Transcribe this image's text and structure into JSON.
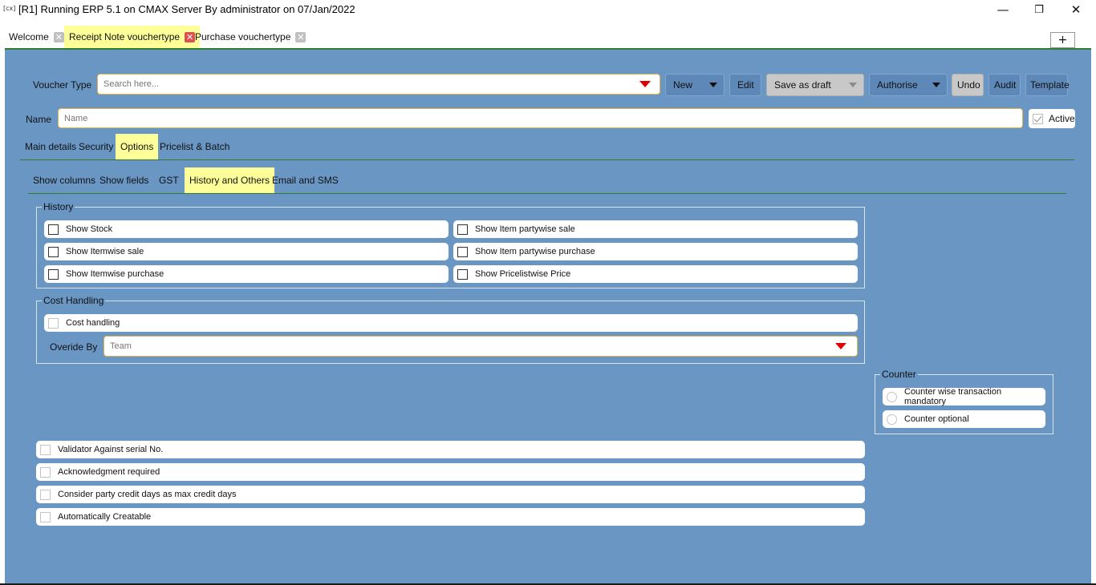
{
  "window": {
    "icon": "[cx]",
    "title": "[R1] Running ERP 5.1 on CMAX Server By administrator on 07/Jan/2022",
    "minimize": "—",
    "restore": "❐",
    "close": "✕"
  },
  "tabs": [
    {
      "label": "Welcome",
      "active": false
    },
    {
      "label": "Receipt Note vouchertype",
      "active": true
    },
    {
      "label": "Purchase vouchertype",
      "active": false
    }
  ],
  "tab_close_glyph": "✕",
  "plus_label": "+",
  "toolbar": {
    "voucher_type_label": "Voucher Type",
    "search_placeholder": "Search here...",
    "new_label": "New",
    "edit_label": "Edit",
    "save_draft_label": "Save as draft",
    "authorise_label": "Authorise",
    "undo_label": "Undo",
    "audit_label": "Audit",
    "template_label": "Template"
  },
  "name_row": {
    "label": "Name",
    "placeholder": "Name",
    "active_label": "Active",
    "active_checked": true
  },
  "main_tabs": [
    {
      "label": "Main details",
      "active": false
    },
    {
      "label": "Security",
      "active": false
    },
    {
      "label": "Options",
      "active": true
    },
    {
      "label": "Pricelist & Batch",
      "active": false
    }
  ],
  "sub_tabs": [
    {
      "label": "Show columns",
      "active": false
    },
    {
      "label": "Show fields",
      "active": false
    },
    {
      "label": "GST",
      "active": false
    },
    {
      "label": "History and Others",
      "active": true
    },
    {
      "label": "Email and SMS",
      "active": false
    }
  ],
  "history": {
    "title": "History",
    "items": [
      {
        "label": "Show Stock",
        "checked": false
      },
      {
        "label": "Show Item partywise sale",
        "checked": false
      },
      {
        "label": "Show Itemwise sale",
        "checked": false
      },
      {
        "label": "Show Item partywise purchase",
        "checked": false
      },
      {
        "label": "Show Itemwise purchase",
        "checked": false
      },
      {
        "label": "Show Pricelistwise Price",
        "checked": false
      }
    ]
  },
  "cost_handling": {
    "title": "Cost Handling",
    "checkbox_label": "Cost handling",
    "checked": false,
    "override_label": "Overide By",
    "override_placeholder": "Team"
  },
  "counter": {
    "title": "Counter",
    "options": [
      {
        "label": "Counter wise transaction mandatory",
        "selected": false
      },
      {
        "label": "Counter optional",
        "selected": false
      }
    ]
  },
  "other_options": [
    {
      "label": "Validator Against serial No.",
      "checked": false
    },
    {
      "label": "Acknowledgment required",
      "checked": false
    },
    {
      "label": "Consider party credit days as max credit days",
      "checked": false
    },
    {
      "label": "Automatically Creatable",
      "checked": false
    }
  ],
  "colors": {
    "panel": "#6a96c3",
    "active_tab": "#ffff99",
    "accent_green": "#2e7d32",
    "field_border": "#e8b34a",
    "dropdown_arrow": "#e00000"
  }
}
